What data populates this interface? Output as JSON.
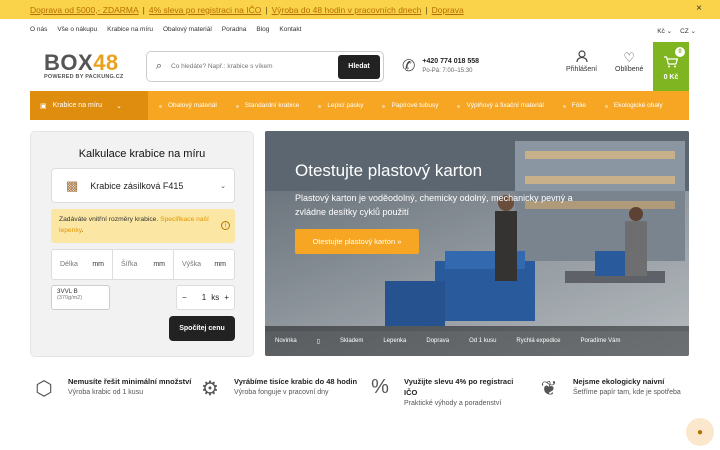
{
  "announcement": {
    "items": [
      "Doprava od 5000,- ZDARMA",
      "4% sleva po registraci na IČO",
      "Výroba do 48 hodin v pracovních dnech",
      "Doprava"
    ],
    "close": "×"
  },
  "topnav": [
    "O nás",
    "Vše o nákupu",
    "Krabice na míru",
    "Obalový materiál",
    "Poradna",
    "Blog",
    "Kontakt"
  ],
  "currency": "Kč",
  "language": "CZ",
  "logo": {
    "part1": "BOX",
    "part2": "48",
    "tagline": "POWERED BY PACKUNG.CZ"
  },
  "search": {
    "placeholder": "Co hledáte? Např.: krabice s víkem",
    "button": "Hledat"
  },
  "phone": {
    "number": "+420 774 018 558",
    "hours": "Po-Pá: 7:00–15:30"
  },
  "header": {
    "login": "Přihlášení",
    "favorites": "Oblíbené",
    "cart_count": "0",
    "cart_total": "0 Kč"
  },
  "categories": {
    "main": "Krabice na míru",
    "items": [
      "Obalový materiál",
      "Standardní krabice",
      "Lepicí pásky",
      "Papírové tubusy",
      "Výplňový a fixační materiál",
      "Fólie",
      "Ekologické obaly"
    ]
  },
  "calculator": {
    "title": "Kalkulace krabice na míru",
    "box_type": "Krabice zásilková F415",
    "note_text": "Zadáváte vnitřní rozměry krabice.",
    "note_link": "Specifikace naší lepenky",
    "dims": [
      {
        "label": "Délka",
        "unit": "mm"
      },
      {
        "label": "Šířka",
        "unit": "mm"
      },
      {
        "label": "Výška",
        "unit": "mm"
      }
    ],
    "material": "3VVL B",
    "material_weight": "(370g/m2)",
    "qty_minus": "−",
    "qty": "1",
    "qty_unit": "ks",
    "qty_plus": "+",
    "button": "Spočítej cenu"
  },
  "hero": {
    "title": "Otestujte plastový karton",
    "text": "Plastový karton je voděodolný, chemicky odolný, mechanicky pevný a zvládne desítky cyklů použití",
    "cta": "Otestujte plastový karton »",
    "tabs": [
      "Novinka",
      "▯",
      "Skladem",
      "Lepenka",
      "Doprava",
      "Od 1 kusu",
      "Rychlá expedice",
      "Poradíme Vám"
    ]
  },
  "features": [
    {
      "title": "Nemusíte řešit minimální množství",
      "sub": "Výroba krabic od 1 kusu",
      "icon": "box-icon"
    },
    {
      "title": "Vyrábíme tisíce krabic do 48 hodin",
      "sub": "Výroba fonguje v pracovní dny",
      "icon": "factory-icon"
    },
    {
      "title": "Využijte slevu 4% po registraci IČO",
      "sub": "Praktické výhody a poradenství",
      "icon": "discount-icon"
    },
    {
      "title": "Nejsme ekologicky naivní",
      "sub": "Šetříme papír tam, kde je spotřeba",
      "icon": "eco-icon"
    }
  ]
}
